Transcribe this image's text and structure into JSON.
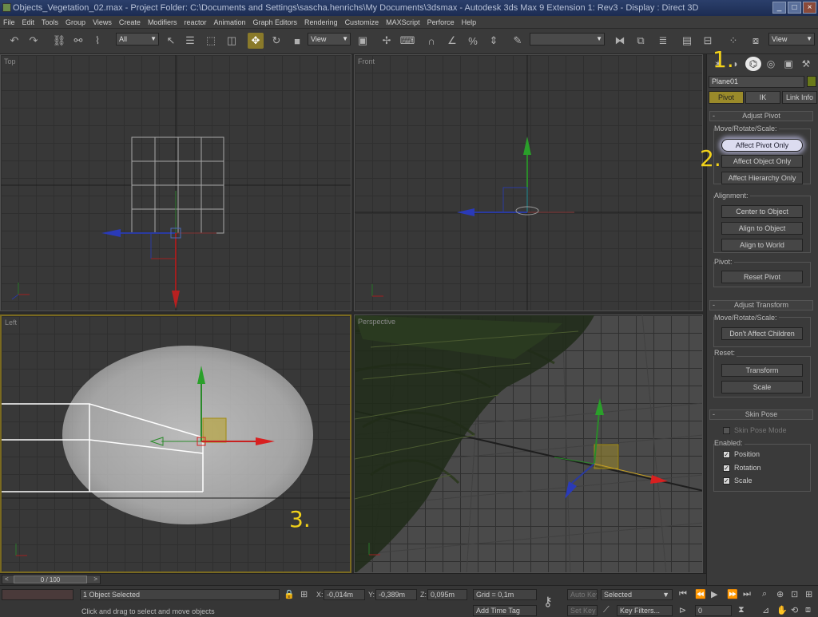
{
  "window": {
    "title": "Objects_Vegetation_02.max    - Project Folder: C:\\Documents and Settings\\sascha.henrichs\\My Documents\\3dsmax    - Autodesk 3ds Max 9 Extension 1: Rev3    - Display : Direct 3D",
    "minimize": "_",
    "maximize": "□",
    "close": "×"
  },
  "menu": [
    "File",
    "Edit",
    "Tools",
    "Group",
    "Views",
    "Create",
    "Modifiers",
    "reactor",
    "Animation",
    "Graph Editors",
    "Rendering",
    "Customize",
    "MAXScript",
    "Perforce",
    "Help"
  ],
  "toolbar": {
    "selection_filter": "All",
    "ref_coord": "View",
    "named_selection": "",
    "render_type": "View",
    "icons": [
      "undo-icon",
      "redo-icon",
      "select-link-icon",
      "unlink-icon",
      "bind-spacewarp-icon",
      "select-object-icon",
      "select-by-name-icon",
      "rect-selection-icon",
      "window-crossing-icon",
      "select-move-icon",
      "select-rotate-icon",
      "select-scale-icon",
      "pivot-center-icon",
      "manipulate-icon",
      "keyboard-shortcut-icon",
      "snap-icon",
      "angle-snap-icon",
      "percent-snap-icon",
      "spinner-snap-icon",
      "edit-named-sel-icon",
      "mirror-icon",
      "align-icon",
      "layer-manager-icon",
      "curve-editor-icon",
      "schematic-view-icon",
      "material-editor-icon",
      "render-scene-icon",
      "quick-render-icon"
    ]
  },
  "viewports": {
    "top": "Top",
    "front": "Front",
    "left": "Left",
    "perspective": "Perspective"
  },
  "callouts": {
    "one": "1.",
    "two": "2.",
    "three": "3."
  },
  "command_panel": {
    "tabs": [
      "create-icon",
      "modify-icon",
      "hierarchy-icon",
      "motion-icon",
      "display-icon",
      "utilities-icon"
    ],
    "active_tab": "hierarchy-icon",
    "object_name": "Plane01",
    "object_color": "#6a7a1a",
    "subtabs": [
      "Pivot",
      "IK",
      "Link Info"
    ],
    "active_subtab": "Pivot",
    "adjust_pivot": {
      "title": "Adjust Pivot",
      "move_label": "Move/Rotate/Scale:",
      "affect_pivot": "Affect Pivot Only",
      "affect_object": "Affect Object Only",
      "affect_hierarchy": "Affect Hierarchy Only",
      "alignment_label": "Alignment:",
      "center": "Center to Object",
      "align_object": "Align to Object",
      "align_world": "Align to World",
      "pivot_label": "Pivot:",
      "reset": "Reset Pivot"
    },
    "adjust_transform": {
      "title": "Adjust Transform",
      "move_label": "Move/Rotate/Scale:",
      "dont_affect": "Don't Affect Children",
      "reset_label": "Reset:",
      "transform": "Transform",
      "scale": "Scale"
    },
    "skin_pose": {
      "title": "Skin Pose",
      "mode": "Skin Pose Mode",
      "enabled_label": "Enabled:",
      "position": "Position",
      "rotation": "Rotation",
      "scale": "Scale",
      "check": "✓"
    },
    "rollout_toggle": "-"
  },
  "timeline": {
    "frame": "0 / 100",
    "prev": "<",
    "next": ">"
  },
  "status": {
    "selected": "1 Object Selected",
    "prompt": "Click and drag to select and move objects",
    "x_label": "X:",
    "x": "-0,014m",
    "y_label": "Y:",
    "y": "-0,389m",
    "z_label": "Z:",
    "z": "0,095m",
    "grid": "Grid = 0,1m",
    "add_time_tag": "Add Time Tag",
    "auto_key": "Auto Key",
    "set_key": "Set Key",
    "key_mode": "Selected",
    "key_filters": "Key Filters...",
    "frame_field": "0"
  }
}
